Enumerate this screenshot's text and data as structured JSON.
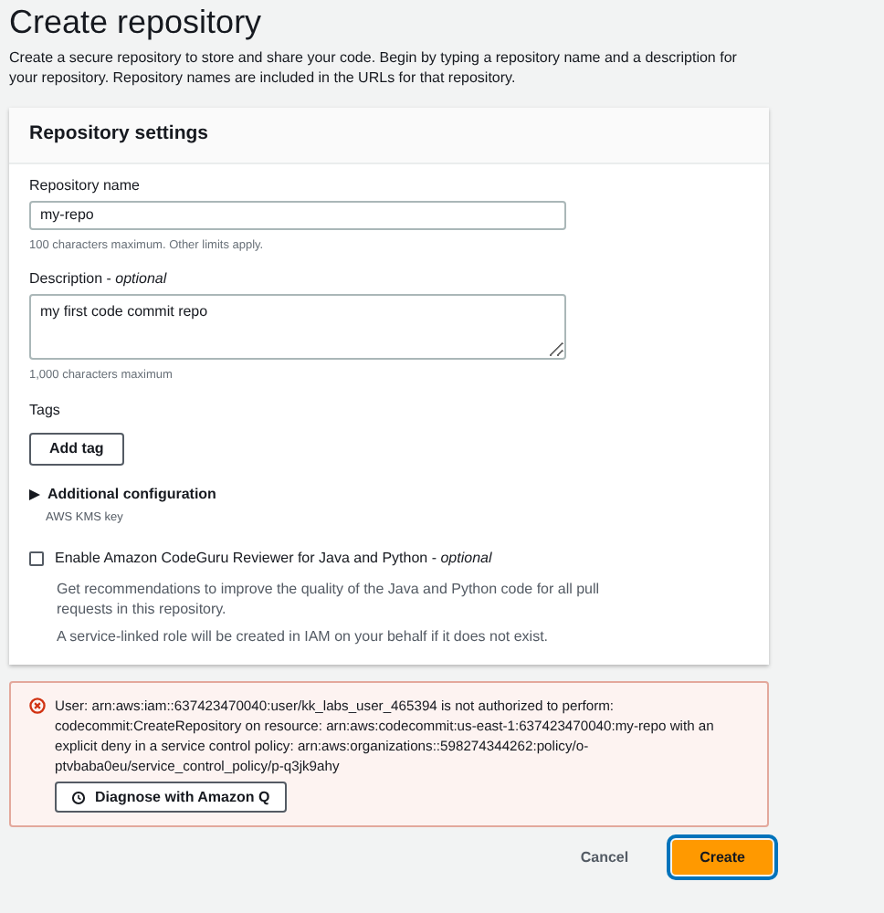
{
  "page": {
    "title": "Create repository",
    "description": "Create a secure repository to store and share your code. Begin by typing a repository name and a description for your repository. Repository names are included in the URLs for that repository."
  },
  "settings": {
    "title": "Repository settings",
    "name_field": {
      "label": "Repository name",
      "value": "my-repo",
      "hint": "100 characters maximum. Other limits apply."
    },
    "description_field": {
      "label": "Description - *optional*",
      "value": "my first code commit repo",
      "hint": "1,000 characters maximum"
    },
    "tags": {
      "label": "Tags",
      "button": "Add tag"
    },
    "additional_configuration": {
      "label": "Additional configuration",
      "subtitle": "AWS KMS key",
      "expanded": false
    },
    "codeguru": {
      "label": "Enable Amazon CodeGuru Reviewer for Java and Python - *optional*",
      "checked": false,
      "description": "Get recommendations to improve the quality of the Java and Python code for all pull requests in this repository.",
      "note": "A service-linked role will be created in IAM on your behalf if it does not exist."
    }
  },
  "error": {
    "message": "User: arn:aws:iam::637423470040:user/kk_labs_user_465394 is not authorized to perform: codecommit:CreateRepository on resource: arn:aws:codecommit:us-east-1:637423470040:my-repo with an explicit deny in a service control policy: arn:aws:organizations::598274344262:policy/o-ptvbaba0eu/service_control_policy/p-q3jk9ahy",
    "button": "Diagnose with Amazon Q"
  },
  "actions": [
    {
      "label": "Cancel",
      "kind": "link"
    },
    {
      "label": "Create",
      "kind": "primary"
    }
  ]
}
